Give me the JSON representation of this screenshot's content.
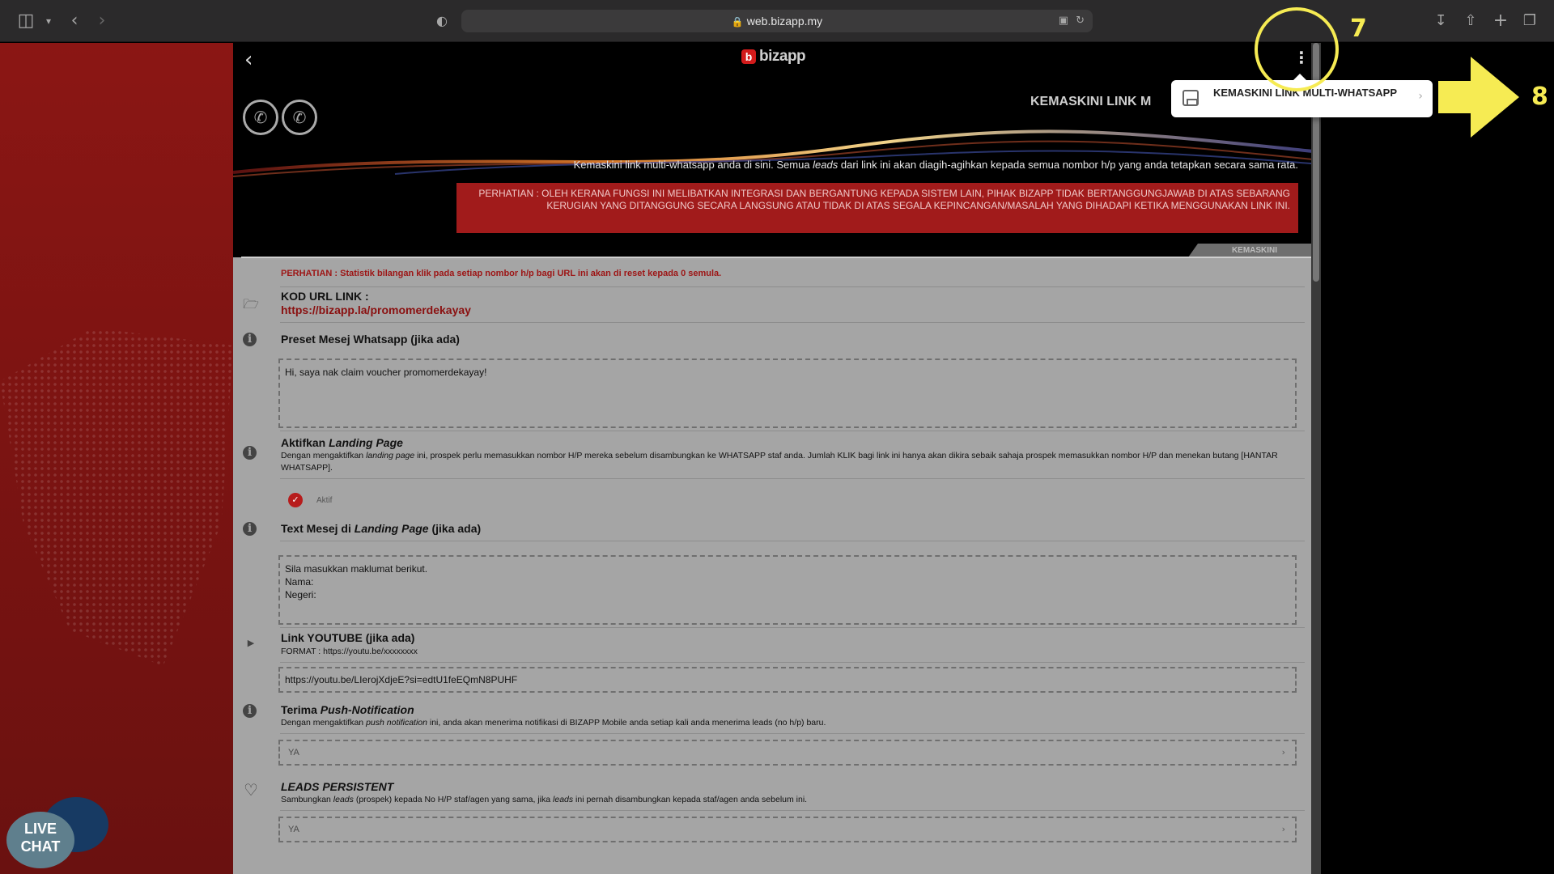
{
  "browser": {
    "url": "web.bizapp.my"
  },
  "app": {
    "logo_text": "bizapp",
    "logo_letter": "b",
    "header_title": "KEMASKINI LINK M",
    "header_desc_1": "Kemaskini link multi-whatsapp anda di sini. Semua ",
    "header_desc_italic": "leads",
    "header_desc_2": " dari link ini akan diagih-agihkan kepada semua nombor h/p yang anda tetapkan secara sama rata.",
    "warning": "PERHATIAN : OLEH KERANA FUNGSI INI MELIBATKAN INTEGRASI DAN BERGANTUNG KEPADA SISTEM LAIN, PIHAK BIZAPP TIDAK BERTANGGUNGJAWAB DI ATAS SEBARANG KERUGIAN YANG DITANGGUNG SECARA LANGSUNG ATAU TIDAK DI ATAS SEGALA KEPINCANGAN/MASALAH YANG DIHADAPI KETIKA MENGGUNAKAN LINK INI.",
    "tab_label": "KEMASKINI"
  },
  "form": {
    "stat_note": "PERHATIAN : Statistik bilangan klik pada setiap nombor h/p bagi URL ini akan di reset kepada 0 semula.",
    "kod_url_label": "KOD URL LINK :",
    "kod_url_value": "https://bizapp.la/promomerdekayay",
    "preset_label": "Preset Mesej Whatsapp (jika ada)",
    "preset_value": "Hi, saya nak claim voucher promomerdekayay!",
    "landing_label_1": "Aktifkan ",
    "landing_label_italic": "Landing Page",
    "landing_help_1": "Dengan mengaktifkan ",
    "landing_help_italic": "landing page",
    "landing_help_2": " ini, prospek perlu memasukkan nombor H/P mereka sebelum disambungkan ke WHATSAPP staf anda. Jumlah KLIK bagi link ini hanya akan dikira sebaik sahaja prospek memasukkan nombor H/P dan menekan butang [HANTAR WHATSAPP].",
    "aktif_label": "Aktif",
    "text_mesej_label_1": "Text Mesej di ",
    "text_mesej_label_italic": "Landing Page",
    "text_mesej_label_2": " (jika ada)",
    "text_mesej_value": "Sila masukkan maklumat berikut.\nNama:\nNegeri:",
    "youtube_label": "Link YOUTUBE (jika ada)",
    "youtube_format": "FORMAT : https://youtu.be/xxxxxxxx",
    "youtube_value": "https://youtu.be/LIerojXdjeE?si=edtU1feEQmN8PUHF",
    "push_label_1": "Terima ",
    "push_label_italic": "Push-Notification",
    "push_help_1": "Dengan mengaktifkan ",
    "push_help_italic": "push notification",
    "push_help_2": " ini, anda akan menerima notifikasi di BIZAPP Mobile anda setiap kali anda menerima leads (no h/p) baru.",
    "push_value": "YA",
    "leads_label": "LEADS PERSISTENT",
    "leads_help_1": "Sambungkan ",
    "leads_help_italic": "leads",
    "leads_help_2": " (prospek) kepada No H/P staf/agen yang sama, jika ",
    "leads_help_italic2": "leads",
    "leads_help_3": " ini pernah disambungkan kepada staf/agen anda sebelum ini.",
    "leads_value": "YA"
  },
  "popup": {
    "item_label": "KEMASKINI LINK MULTI-WHATSAPP"
  },
  "annotations": {
    "step_7": "7",
    "step_8": "8"
  },
  "livechat": {
    "line1": "LIVE",
    "line2": "CHAT"
  },
  "colors": {
    "brand_red": "#d21b1b",
    "warning_bg": "#a11b1b",
    "annotation_yellow": "#f6eb53"
  }
}
